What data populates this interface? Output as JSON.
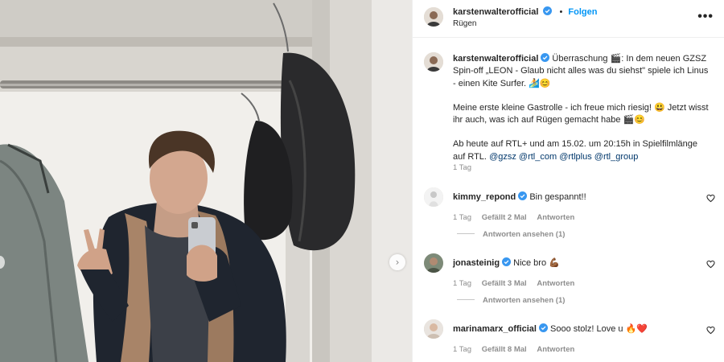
{
  "header": {
    "username": "karstenwalterofficial",
    "follow_label": "Folgen",
    "location": "Rügen",
    "separator": "•",
    "more_label": "•••"
  },
  "caption": {
    "username": "karstenwalterofficial",
    "p1_text": " Überraschung 🎬: In dem neuen GZSZ Spin-off „LEON - Glaub nicht alles was du siehst\" spiele ich Linus - einen Kite Surfer. 🏄😊",
    "p2_text": "Meine erste kleine Gastrolle - ich freue mich riesig! 😃 Jetzt wisst ihr auch, was ich auf Rügen gemacht habe 🎬😊",
    "p3_text": "Ab heute auf RTL+ und am 15.02. um 20:15h in Spielfilmlänge auf RTL.",
    "mentions": [
      "@gzsz",
      "@rtl_com",
      "@rtlplus",
      "@rtl_group"
    ],
    "time": "1 Tag"
  },
  "comments": [
    {
      "username": "kimmy_repond",
      "text": "Bin gespannt!!",
      "time": "1 Tag",
      "likes": "Gefällt 2 Mal",
      "reply_label": "Antworten",
      "view_replies": "Antworten ansehen (1)"
    },
    {
      "username": "jonasteinig",
      "text": "Nice bro 💪🏾",
      "time": "1 Tag",
      "likes": "Gefällt 3 Mal",
      "reply_label": "Antworten",
      "view_replies": "Antworten ansehen (1)"
    },
    {
      "username": "marinamarx_official",
      "text": "Sooo stolz! Love u 🔥❤️",
      "time": "1 Tag",
      "likes": "Gefällt 8 Mal",
      "reply_label": "Antworten"
    }
  ],
  "nav": {
    "next_label": "›"
  },
  "colors": {
    "accent": "#0095f6",
    "verified": "#3897f0",
    "mention": "#00376b",
    "muted": "#8e8e8e"
  }
}
